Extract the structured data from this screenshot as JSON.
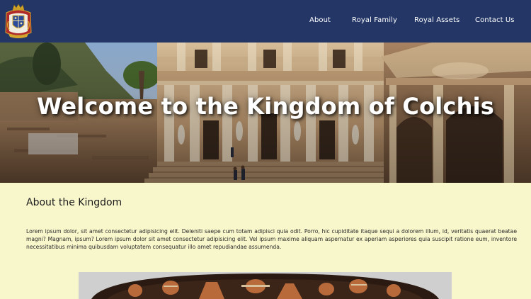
{
  "header": {
    "logo_icon": "royal-coat-of-arms-icon",
    "nav": {
      "about": "About",
      "royal_family": "Royal Family",
      "royal_assets": "Royal Assets",
      "contact_us": "Contact Us"
    }
  },
  "hero": {
    "title": "Welcome to the Kingdom of Colchis"
  },
  "about": {
    "heading": "About the Kingdom",
    "text": "Lorem ipsum dolor, sit amet consectetur adipisicing elit. Deleniti saepe cum totam adipisci quia odit. Porro, hic cupiditate itaque sequi a dolorem illum, id, veritatis quaerat beatae magni? Magnam, ipsum? Lorem ipsum dolor sit amet consectetur adipisicing elit. Vel ipsum maxime aliquam aspernatur ex aperiam asperiores quia suscipit ratione eum, inventore necessitatibus minima quibusdam voluptatem consequatur illo amet repudiandae assumenda."
  },
  "colors": {
    "navbar": "#233665",
    "page_background": "#f8f6cb",
    "nav_text": "#ffffff"
  }
}
